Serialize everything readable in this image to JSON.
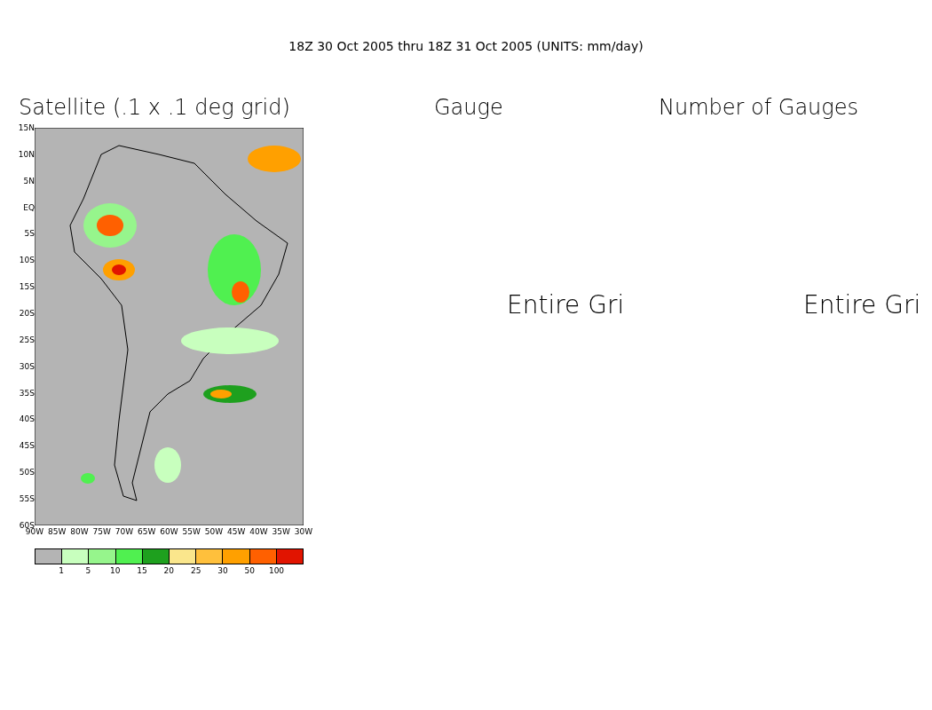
{
  "title": "18Z 30 Oct 2005 thru 18Z 31 Oct 2005 (UNITS: mm/day)",
  "panels": [
    {
      "kind": "map",
      "title": "Satellite (.1 x .1 deg grid)",
      "lat_labels": [
        "15N",
        "10N",
        "5N",
        "EQ",
        "5S",
        "10S",
        "15S",
        "20S",
        "25S",
        "30S",
        "35S",
        "40S",
        "45S",
        "50S",
        "55S",
        "60S"
      ],
      "lon_labels": [
        "90W",
        "85W",
        "80W",
        "75W",
        "70W",
        "65W",
        "60W",
        "55W",
        "50W",
        "45W",
        "40W",
        "35W",
        "30W"
      ],
      "legend": {
        "boxes": [
          {
            "color": "#b4b4b4"
          },
          {
            "color": "#c8ffbe"
          },
          {
            "color": "#96f58c"
          },
          {
            "color": "#50f050"
          },
          {
            "color": "#1ea01e"
          },
          {
            "color": "#fae68c"
          },
          {
            "color": "#ffc03c"
          },
          {
            "color": "#ffa000"
          },
          {
            "color": "#ff6000"
          },
          {
            "color": "#e11400"
          }
        ],
        "labels": [
          "1",
          "5",
          "10",
          "15",
          "20",
          "25",
          "30",
          "50",
          "100"
        ]
      }
    },
    {
      "kind": "message",
      "title": "Gauge",
      "message": "Entire Gri"
    },
    {
      "kind": "message",
      "title": "Number of Gauges",
      "message": "Entire Gri"
    }
  ]
}
